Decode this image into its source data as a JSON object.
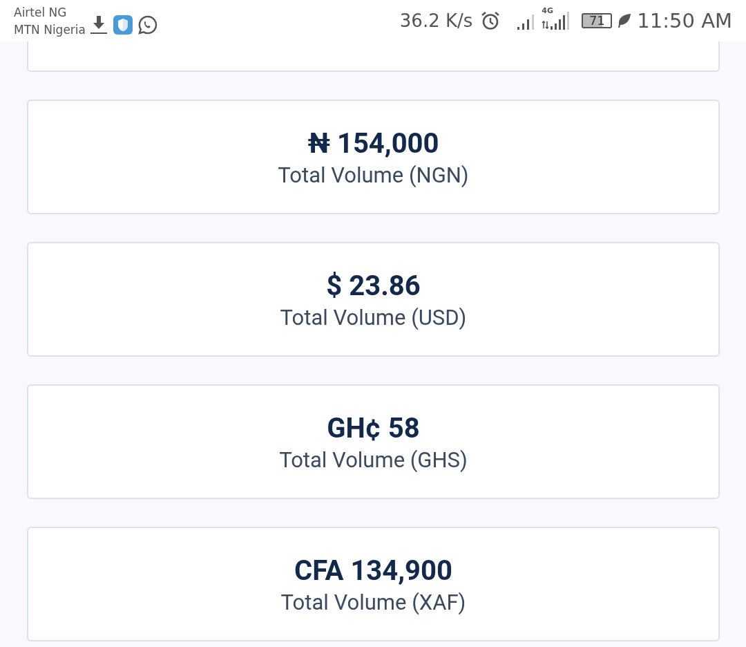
{
  "status_bar": {
    "carriers": [
      "Airtel NG",
      "MTN Nigeria"
    ],
    "speed": "36.2 K/s",
    "network": "4G",
    "battery": "71",
    "time": "11:50 AM"
  },
  "cards": [
    {
      "value": "₦ 154,000",
      "label": "Total Volume (NGN)"
    },
    {
      "value": "$ 23.86",
      "label": "Total Volume (USD)"
    },
    {
      "value": "GH¢ 58",
      "label": "Total Volume (GHS)"
    },
    {
      "value": "CFA 134,900",
      "label": "Total Volume (XAF)"
    }
  ]
}
